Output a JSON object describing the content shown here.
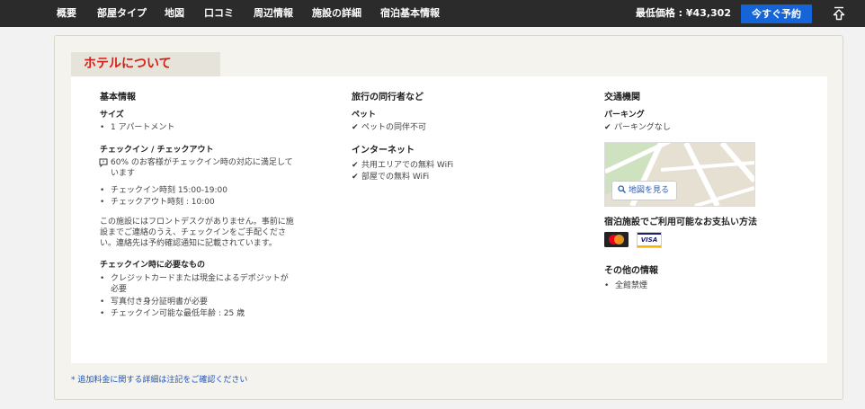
{
  "nav": {
    "items": [
      "概要",
      "部屋タイプ",
      "地図",
      "口コミ",
      "周辺情報",
      "施設の詳細",
      "宿泊基本情報"
    ],
    "price_text": "最低価格 : ¥43,302",
    "reserve_label": "今すぐ予約"
  },
  "section": {
    "title": "ホテルについて"
  },
  "col1": {
    "heading": "基本情報",
    "size_title": "サイズ",
    "size_items": [
      "1 アパートメント"
    ],
    "checkin_title": "チェックイン / チェックアウト",
    "satisfaction": "60% のお客様がチェックイン時の対応に満足しています",
    "checkin_items": [
      "チェックイン時刻 15:00-19:00",
      "チェックアウト時刻 : 10:00"
    ],
    "note": "この施設にはフロントデスクがありません。事前に施設までご連絡のうえ、チェックインをご手配ください。連絡先は予約確認通知に記載されています。",
    "required_title": "チェックイン時に必要なもの",
    "required_items": [
      "クレジットカードまたは現金によるデポジットが必要",
      "写真付き身分証明書が必要",
      "チェックイン可能な最低年齢 : 25 歳"
    ]
  },
  "col2": {
    "heading": "旅行の同行者など",
    "pet_title": "ペット",
    "pet_items": [
      "ペットの同伴不可"
    ],
    "internet_title": "インターネット",
    "internet_items": [
      "共用エリアでの無料 WiFi",
      "部屋での無料 WiFi"
    ]
  },
  "col3": {
    "heading": "交通機関",
    "parking_title": "パーキング",
    "parking_items": [
      "パーキングなし"
    ],
    "map_button": "地図を見る",
    "payment_title": "宿泊施設でご利用可能なお支払い方法",
    "card_visa": "VISA",
    "other_title": "その他の情報",
    "other_items": [
      "全館禁煙"
    ]
  },
  "footnote": "* 追加料金に関する詳細は注記をご確認ください",
  "colors": {
    "accent_red": "#d5201a",
    "button_blue": "#1565d8",
    "link_blue": "#1f56b8",
    "nav_bg": "#2b2b2b"
  },
  "icons": [
    "arrow-up-icon",
    "chat-bubble-icon",
    "check-icon",
    "search-icon",
    "mastercard-icon",
    "visa-icon"
  ]
}
